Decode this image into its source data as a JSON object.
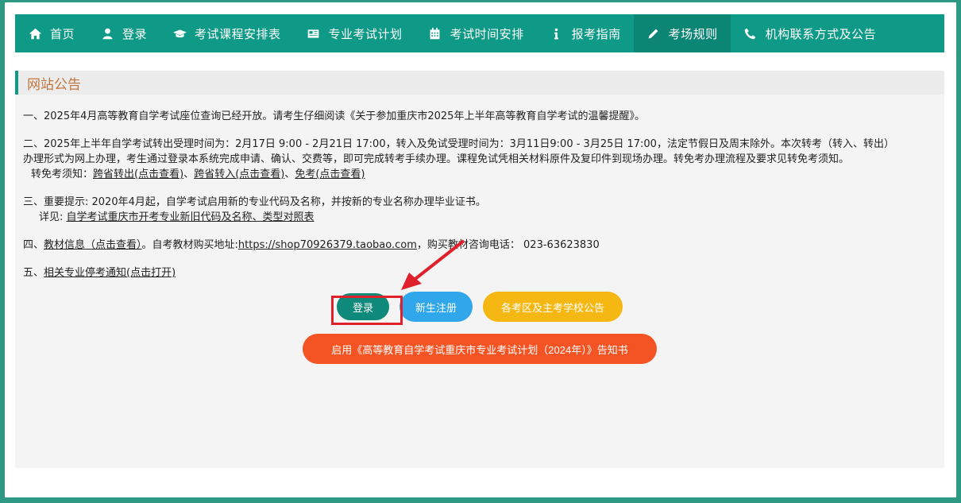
{
  "nav": {
    "items": [
      {
        "label": "首页",
        "icon": "home-icon"
      },
      {
        "label": "登录",
        "icon": "user-icon"
      },
      {
        "label": "考试课程安排表",
        "icon": "graduation-cap-icon"
      },
      {
        "label": "专业考试计划",
        "icon": "newspaper-icon"
      },
      {
        "label": "考试时间安排",
        "icon": "calendar-icon"
      },
      {
        "label": "报考指南",
        "icon": "info-icon"
      },
      {
        "label": "考场规则",
        "icon": "pencil-icon"
      },
      {
        "label": "机构联系方式及公告",
        "icon": "phone-icon"
      }
    ],
    "active": "考场规则"
  },
  "panel": {
    "title": "网站公告"
  },
  "notices": {
    "n1": "一、2025年4月高等教育自学考试座位查询已经开放。请考生仔细阅读《关于参加重庆市2025年上半年高等教育自学考试的温馨提醒》。",
    "n2_line1": "二、2025年上半年自学考试转出受理时间为：2月17日 9:00 - 2月21日 17:00，转入及免试受理时间为：3月11日9:00 - 3月25日 17:00，法定节假日及周末除外。本次转考（转入、转出）",
    "n2_line2": "办理形式为网上办理，考生通过登录本系统完成申请、确认、交费等，即可完成转考手续办理。课程免试凭相关材料原件及复印件到现场办理。转免考办理流程及要求见转免考须知。",
    "n2_prefix": "转免考须知：",
    "n2_link1": "跨省转出(点击查看)",
    "n2_sep1": "、",
    "n2_link2": "跨省转入(点击查看)",
    "n2_sep2": "、",
    "n2_link3": "免考(点击查看)",
    "n3_line1": "三、重要提示: 2020年4月起，自学考试启用新的专业代码及名称，并按新的专业名称办理毕业证书。",
    "n3_prefix": "详见: ",
    "n3_link": "自学考试重庆市开考专业新旧代码及名称、类型对照表",
    "n4_prefix": "四、",
    "n4_link1": "教材信息（点击查看）",
    "n4_mid": "。自考教材购买地址:",
    "n4_link2": "https://shop70926379.taobao.com",
    "n4_suffix": "，购买教材咨询电话： 023-63623830",
    "n5_prefix": "五、",
    "n5_link": "相关专业停考通知(点击打开)"
  },
  "buttons": {
    "login": "登录",
    "register": "新生注册",
    "exam_notice": "各考区及主考学校公告",
    "plan_notice": "启用《高等教育自学考试重庆市专业考试计划（2024年）》告知书"
  },
  "colors": {
    "brand": "#0e9a86",
    "title": "#c3753f",
    "login": "#0f8a7a",
    "register": "#2fa7ea",
    "exam_notice": "#f5b712",
    "plan_notice": "#f45423",
    "annotation": "#e0202a"
  }
}
